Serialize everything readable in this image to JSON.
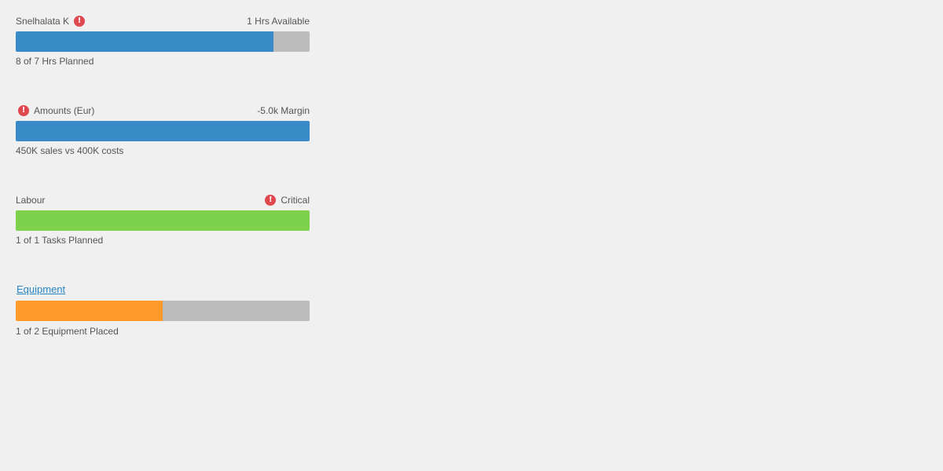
{
  "colors": {
    "background": "#f0f0f0",
    "track": "#bcbcbc",
    "blue": "#388bc6",
    "green": "#7ed14d",
    "orange": "#ff9a2b",
    "alert": "#e0484f",
    "link": "#2a86c2"
  },
  "cards": [
    {
      "title": "Snelhalata K",
      "status_text": "1 Hrs Available",
      "alert_icon": "exclamation-circle-icon",
      "progress_fraction": 0.878,
      "fill_color": "#388bc6",
      "caption": "8 of 7 Hrs Planned"
    },
    {
      "title": "Amounts (Eur)",
      "status_text": "-5.0k Margin",
      "alert_icon": "exclamation-circle-icon",
      "progress_fraction": 1.0,
      "fill_color": "#388bc6",
      "caption": "450K sales vs 400K costs"
    },
    {
      "title": "Labour",
      "status_text": "Critical",
      "alert_icon": "exclamation-circle-icon",
      "progress_fraction": 1.0,
      "fill_color": "#7ed14d",
      "caption": "1 of 1 Tasks Planned"
    },
    {
      "title": "Equipment",
      "status_text": "",
      "progress_fraction": 0.5,
      "fill_color": "#ff9a2b",
      "caption": "1 of 2 Equipment Placed"
    }
  ]
}
